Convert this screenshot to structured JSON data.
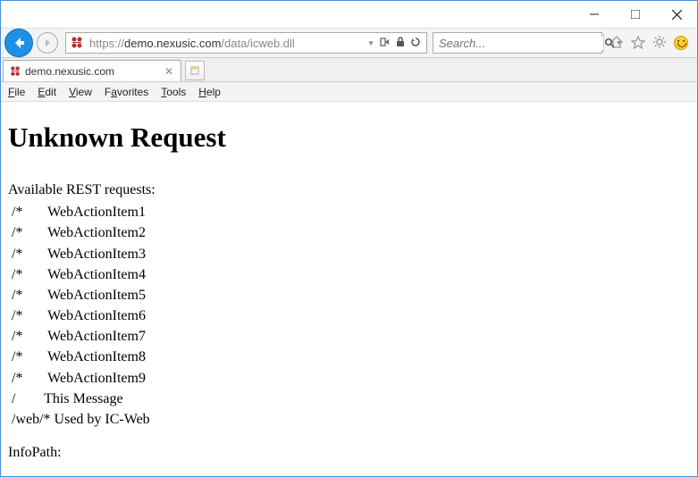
{
  "window": {
    "minimize": "Minimize",
    "maximize": "Restore",
    "close": "Close"
  },
  "nav": {
    "url_protocol": "https://",
    "url_host": "demo.nexusic.com",
    "url_path": "/data/icweb.dll",
    "search_placeholder": "Search..."
  },
  "tab": {
    "title": "demo.nexusic.com"
  },
  "menu": {
    "file": "File",
    "edit": "Edit",
    "view": "View",
    "favorites": "Favorites",
    "tools": "Tools",
    "help": "Help"
  },
  "page": {
    "heading": "Unknown Request",
    "available": "Available REST requests:",
    "rows": [
      {
        "path": "/*",
        "desc": "WebActionItem1"
      },
      {
        "path": "/*",
        "desc": "WebActionItem2"
      },
      {
        "path": "/*",
        "desc": "WebActionItem3"
      },
      {
        "path": "/*",
        "desc": "WebActionItem4"
      },
      {
        "path": "/*",
        "desc": "WebActionItem5"
      },
      {
        "path": "/*",
        "desc": "WebActionItem6"
      },
      {
        "path": "/*",
        "desc": "WebActionItem7"
      },
      {
        "path": "/*",
        "desc": "WebActionItem8"
      },
      {
        "path": "/*",
        "desc": "WebActionItem9"
      },
      {
        "path": "/",
        "desc": "This Message"
      },
      {
        "path": "/web/*",
        "desc": "Used by IC-Web"
      }
    ],
    "infopath": "InfoPath:"
  }
}
